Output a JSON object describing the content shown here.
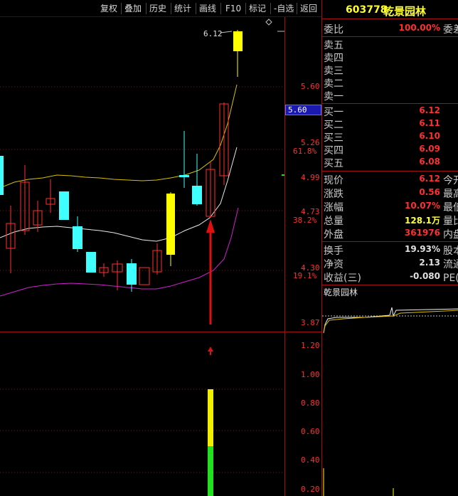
{
  "toolbar": {
    "buttons": [
      "复权",
      "叠加",
      "历史",
      "统计",
      "画线",
      "F10",
      "标记",
      "-自选",
      "返回"
    ]
  },
  "chart": {
    "price_axis": [
      "5.60",
      "5.26",
      "4.99",
      "4.73",
      "4.30",
      "3.87"
    ],
    "fib_labels": [
      "61.8%",
      "38.2%",
      "19.1%"
    ],
    "current_price_tag": "5.60",
    "high_marker": "6.12",
    "sub_axis": [
      "1.20",
      "1.00",
      "0.80",
      "0.60",
      "0.40",
      "0.20"
    ]
  },
  "quote": {
    "code": "603778",
    "name": "乾景园林",
    "webi_label": "委比",
    "webi_value": "100.00%",
    "webi_label2": "委差",
    "asks": [
      {
        "label": "卖五",
        "price": ""
      },
      {
        "label": "卖四",
        "price": ""
      },
      {
        "label": "卖三",
        "price": ""
      },
      {
        "label": "卖二",
        "price": ""
      },
      {
        "label": "卖一",
        "price": ""
      }
    ],
    "bids": [
      {
        "label": "买一",
        "price": "6.12"
      },
      {
        "label": "买二",
        "price": "6.11"
      },
      {
        "label": "买三",
        "price": "6.10"
      },
      {
        "label": "买四",
        "price": "6.09"
      },
      {
        "label": "买五",
        "price": "6.08"
      }
    ],
    "stats": [
      {
        "label": "现价",
        "value": "6.12",
        "label2": "今开"
      },
      {
        "label": "涨跌",
        "value": "0.56",
        "label2": "最高"
      },
      {
        "label": "涨幅",
        "value": "10.07%",
        "label2": "最低"
      },
      {
        "label": "总量",
        "value": "128.1万",
        "label2": "量比"
      },
      {
        "label": "外盘",
        "value": "361976",
        "label2": "内盘"
      }
    ],
    "stats2": [
      {
        "label": "换手",
        "value": "19.93%",
        "label2": "股本"
      },
      {
        "label": "净资",
        "value": "2.13",
        "label2": "流通"
      },
      {
        "label": "收益(三)",
        "value": "-0.080",
        "label2": "PE(动)"
      }
    ],
    "mini_chart_title": "乾景园林"
  },
  "colors": {
    "up": "#ff3030",
    "down": "#40ffff",
    "limit_up": "#ffff00",
    "border": "#a01010"
  }
}
